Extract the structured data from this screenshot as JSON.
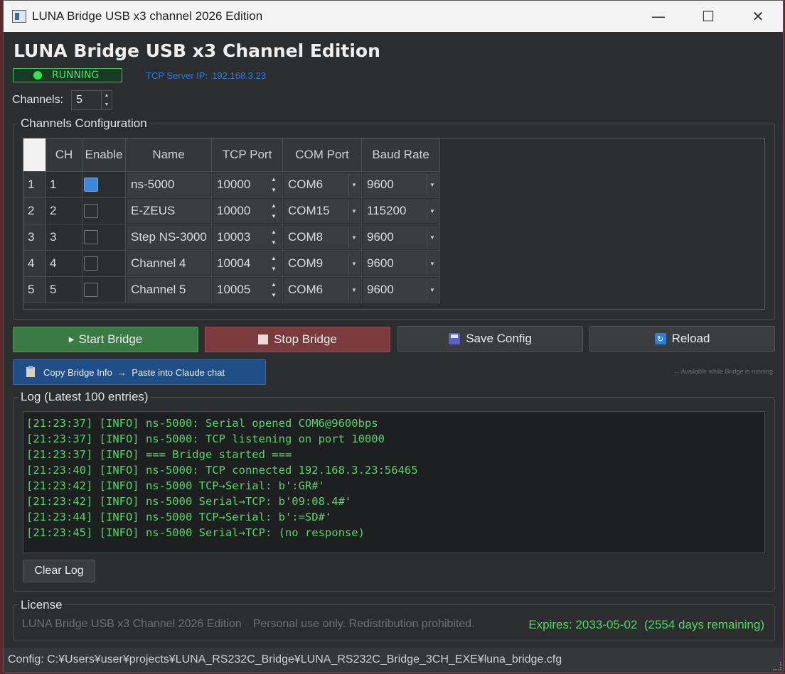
{
  "window": {
    "title": "LUNA Bridge USB x3 channel 2026 Edition",
    "controls": {
      "minimize": "—",
      "maximize": "☐",
      "close": "✕"
    }
  },
  "header": {
    "title": "LUNA Bridge USB x3 Channel Edition",
    "status": "RUNNING",
    "tcp_label": "TCP Server IP:",
    "tcp_ip": "192.168.3.23"
  },
  "channels_control": {
    "label": "Channels:",
    "value": "5"
  },
  "config": {
    "title": "Channels Configuration",
    "columns": [
      "CH",
      "Enable",
      "Name",
      "TCP Port",
      "COM Port",
      "Baud Rate"
    ],
    "rows": [
      {
        "row": "1",
        "ch": "1",
        "enabled": true,
        "name": "ns-5000",
        "tcp": "10000",
        "com": "COM6",
        "baud": "9600"
      },
      {
        "row": "2",
        "ch": "2",
        "enabled": false,
        "name": "E-ZEUS",
        "tcp": "10000",
        "com": "COM15",
        "baud": "115200"
      },
      {
        "row": "3",
        "ch": "3",
        "enabled": false,
        "name": "Step NS-3000",
        "tcp": "10003",
        "com": "COM8",
        "baud": "9600"
      },
      {
        "row": "4",
        "ch": "4",
        "enabled": false,
        "name": "Channel 4",
        "tcp": "10004",
        "com": "COM9",
        "baud": "9600"
      },
      {
        "row": "5",
        "ch": "5",
        "enabled": false,
        "name": "Channel 5",
        "tcp": "10005",
        "com": "COM6",
        "baud": "9600"
      }
    ]
  },
  "actions": {
    "start": "Start Bridge",
    "stop": "Stop Bridge",
    "save": "Save Config",
    "reload": "Reload",
    "copy_info": "Copy Bridge Info  →  Paste into Claude chat",
    "copy_hint": "← Available while Bridge is running"
  },
  "log": {
    "title": "Log (Latest 100 entries)",
    "lines": [
      "[21:23:37] [INFO] ns-5000: Serial opened COM6@9600bps",
      "[21:23:37] [INFO] ns-5000: TCP listening on port 10000",
      "[21:23:37] [INFO] === Bridge started ===",
      "[21:23:40] [INFO] ns-5000: TCP connected 192.168.3.23:56465",
      "[21:23:42] [INFO] ns-5000 TCP→Serial: b':GR#'",
      "[21:23:42] [INFO] ns-5000 Serial→TCP: b'09:08.4#'",
      "[21:23:44] [INFO] ns-5000 TCP→Serial: b':=SD#'",
      "[21:23:45] [INFO] ns-5000 Serial→TCP: (no response)"
    ],
    "clear": "Clear Log"
  },
  "license": {
    "title": "License",
    "product": "LUNA Bridge USB x3 Channel 2026 Edition",
    "terms": "Personal use only. Redistribution prohibited.",
    "expires": "Expires: 2033-05-02  (2554 days remaining)"
  },
  "statusbar": {
    "config_path": "Config: C:¥Users¥user¥projects¥LUNA_RS232C_Bridge¥LUNA_RS232C_Bridge_3CH_EXE¥luna_bridge.cfg"
  },
  "colors": {
    "accent_blue": "#2a7de1",
    "running_green": "#35e24f",
    "start_green": "#3a7b45",
    "stop_red": "#7a3b3f",
    "log_green": "#58d468"
  }
}
